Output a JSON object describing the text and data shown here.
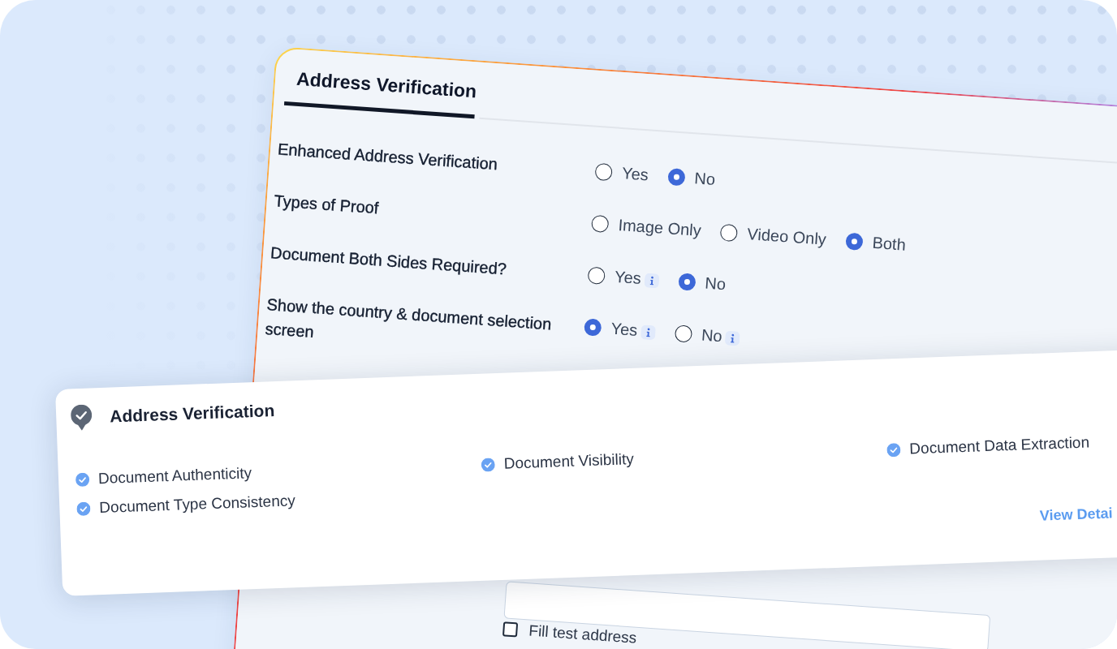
{
  "settings_panel": {
    "tabs": [
      {
        "label": "Address Verification",
        "selected": true
      }
    ],
    "questions": [
      {
        "label": "Enhanced Address Verification",
        "options": [
          {
            "label": "Yes",
            "selected": false,
            "info": false
          },
          {
            "label": "No",
            "selected": true,
            "info": false
          }
        ]
      },
      {
        "label": "Types of Proof",
        "options": [
          {
            "label": "Image Only",
            "selected": false,
            "info": false
          },
          {
            "label": "Video Only",
            "selected": false,
            "info": false
          },
          {
            "label": "Both",
            "selected": true,
            "info": false
          }
        ]
      },
      {
        "label": "Document Both Sides Required?",
        "options": [
          {
            "label": "Yes",
            "selected": false,
            "info": true
          },
          {
            "label": "No",
            "selected": true,
            "info": false
          }
        ]
      },
      {
        "label": "Show the country & document selection screen",
        "options": [
          {
            "label": "Yes",
            "selected": true,
            "info": true
          },
          {
            "label": "No",
            "selected": false,
            "info": true
          }
        ]
      }
    ],
    "fill_test_address": {
      "label": "Fill test address",
      "checked": false
    }
  },
  "summary_card": {
    "title": "Address Verification",
    "columns": [
      {
        "items": [
          "Document Authenticity",
          "Document Type Consistency"
        ]
      },
      {
        "items": [
          "Document Visibility"
        ]
      },
      {
        "items": [
          "Document Data Extraction"
        ]
      }
    ],
    "link": "View Detai"
  }
}
